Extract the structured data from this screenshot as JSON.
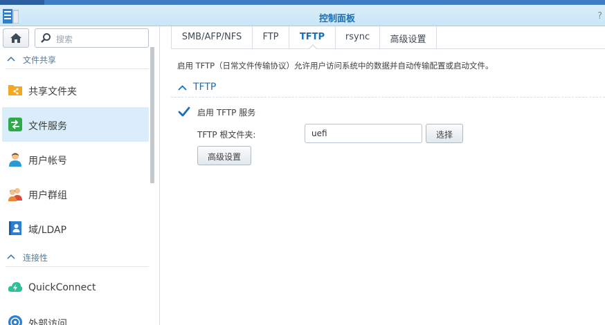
{
  "window": {
    "title": "控制面板",
    "help_icon": "?"
  },
  "sidebar": {
    "search_placeholder": "搜索",
    "sections": [
      {
        "label": "文件共享",
        "items": [
          {
            "label": "共享文件夹",
            "icon": "shared-folder-icon",
            "active": false
          },
          {
            "label": "文件服务",
            "icon": "file-services-icon",
            "active": true
          },
          {
            "label": "用户帐号",
            "icon": "user-icon",
            "active": false
          },
          {
            "label": "用户群组",
            "icon": "group-icon",
            "active": false
          },
          {
            "label": "域/LDAP",
            "icon": "domain-ldap-icon",
            "active": false
          }
        ]
      },
      {
        "label": "连接性",
        "items": [
          {
            "label": "QuickConnect",
            "icon": "quickconnect-icon",
            "active": false
          },
          {
            "label": "外部访问",
            "icon": "external-access-icon",
            "active": false
          }
        ]
      }
    ]
  },
  "tabs": [
    {
      "label": "SMB/AFP/NFS",
      "active": false
    },
    {
      "label": "FTP",
      "active": false
    },
    {
      "label": "TFTP",
      "active": true
    },
    {
      "label": "rsync",
      "active": false
    },
    {
      "label": "高级设置",
      "active": false
    }
  ],
  "content": {
    "description": "启用 TFTP（日常文件传输协议）允许用户访问系统中的数据并自动传输配置或启动文件。",
    "fieldset_title": "TFTP",
    "enable_label": "启用 TFTP 服务",
    "enable_checked": true,
    "root_folder_label": "TFTP 根文件夹:",
    "root_folder_value": "uefi",
    "select_button": "选择",
    "advanced_button": "高级设置"
  },
  "colors": {
    "accent": "#1a6eb5",
    "active_item_bg": "#d9edfb",
    "section_label": "#4b7cad"
  }
}
